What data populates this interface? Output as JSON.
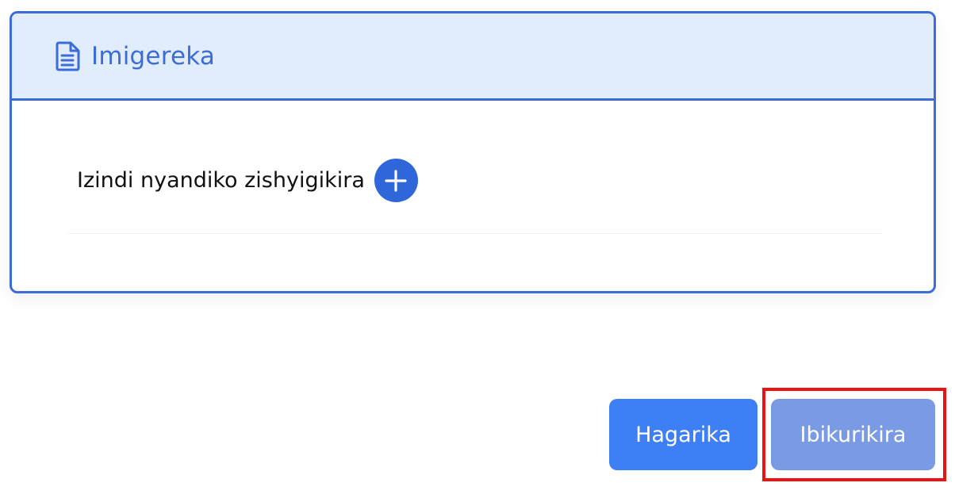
{
  "attachments_panel": {
    "title": "Imigereka",
    "icon": "document-icon",
    "row": {
      "label": "Izindi nyandiko zishyigikira",
      "add_icon": "plus-circle-icon"
    }
  },
  "actions": {
    "cancel_label": "Hagarika",
    "next_label": "Ibikurikira"
  },
  "colors": {
    "accent": "#3b6cd8",
    "header_bg": "#e1edfa",
    "primary_button": "#3f7ff6",
    "disabled_button": "#7a9be3",
    "highlight": "#ee1111"
  }
}
